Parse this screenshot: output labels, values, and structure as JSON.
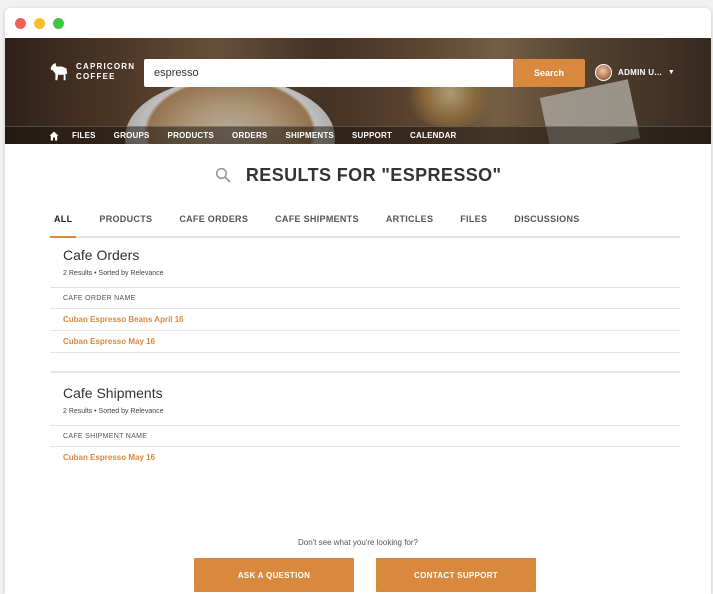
{
  "brand": {
    "line1": "CAPRICORN",
    "line2": "COFFEE",
    "accent": "#d8893e"
  },
  "search": {
    "value": "espresso",
    "button_label": "Search"
  },
  "user": {
    "name": "ADMIN U..."
  },
  "nav": {
    "items": [
      "FILES",
      "GROUPS",
      "PRODUCTS",
      "ORDERS",
      "SHIPMENTS",
      "SUPPORT",
      "CALENDAR"
    ]
  },
  "results_title": "RESULTS FOR \"ESPRESSO\"",
  "tabs": [
    "ALL",
    "PRODUCTS",
    "CAFE ORDERS",
    "CAFE SHIPMENTS",
    "ARTICLES",
    "FILES",
    "DISCUSSIONS"
  ],
  "sections": [
    {
      "title": "Cafe Orders",
      "meta": "2 Results • Sorted by Relevance",
      "column": "CAFE ORDER NAME",
      "rows": [
        "Cuban Espresso Beans April 16",
        "Cuban Espresso May 16"
      ]
    },
    {
      "title": "Cafe Shipments",
      "meta": "2 Results • Sorted by Relevance",
      "column": "CAFE SHIPMENT NAME",
      "rows": [
        "Cuban Espresso May 16"
      ]
    }
  ],
  "footer": {
    "prompt": "Don't see what you're looking for?",
    "ask_label": "ASK A QUESTION",
    "contact_label": "CONTACT SUPPORT"
  }
}
